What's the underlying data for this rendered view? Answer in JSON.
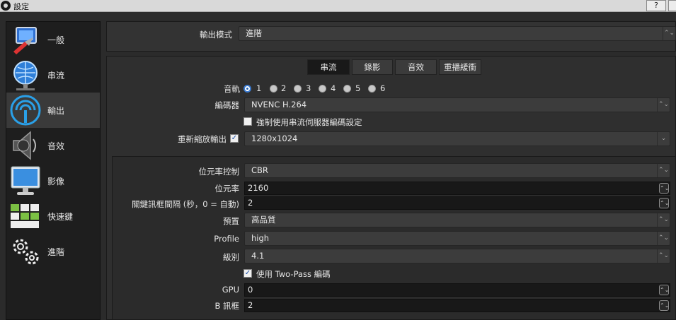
{
  "window": {
    "title": "設定",
    "help_label": "?"
  },
  "sidebar": {
    "items": [
      {
        "label": "一般",
        "icon": "general-icon"
      },
      {
        "label": "串流",
        "icon": "stream-globe-icon"
      },
      {
        "label": "輸出",
        "icon": "output-icon",
        "active": true
      },
      {
        "label": "音效",
        "icon": "speaker-icon"
      },
      {
        "label": "影像",
        "icon": "monitor-icon"
      },
      {
        "label": "快速鍵",
        "icon": "keyboard-icon"
      },
      {
        "label": "進階",
        "icon": "gears-icon"
      }
    ]
  },
  "output_mode": {
    "label": "輸出模式",
    "value": "進階"
  },
  "tabs": [
    {
      "label": "串流",
      "active": true
    },
    {
      "label": "錄影"
    },
    {
      "label": "音效"
    },
    {
      "label": "重播緩衝"
    }
  ],
  "stream": {
    "audio_track": {
      "label": "音軌",
      "options": [
        "1",
        "2",
        "3",
        "4",
        "5",
        "6"
      ],
      "selected": "1"
    },
    "encoder": {
      "label": "編碼器",
      "value": "NVENC H.264"
    },
    "enforce_service": {
      "label": "強制使用串流伺服器編碼設定",
      "checked": false
    },
    "rescale": {
      "label": "重新縮放輸出",
      "checked": true,
      "value": "1280x1024"
    },
    "rate_control": {
      "label": "位元率控制",
      "value": "CBR"
    },
    "bitrate": {
      "label": "位元率",
      "value": "2160"
    },
    "keyframe": {
      "label": "關鍵訊框間隔 (秒，0 = 自動)",
      "value": "2"
    },
    "preset": {
      "label": "預置",
      "value": "高品質"
    },
    "profile": {
      "label": "Profile",
      "value": "high"
    },
    "level": {
      "label": "級別",
      "value": "4.1"
    },
    "two_pass": {
      "label": "使用 Two-Pass 編碼",
      "checked": true
    },
    "gpu": {
      "label": "GPU",
      "value": "0"
    },
    "b_frames": {
      "label": "B 訊框",
      "value": "2"
    }
  }
}
